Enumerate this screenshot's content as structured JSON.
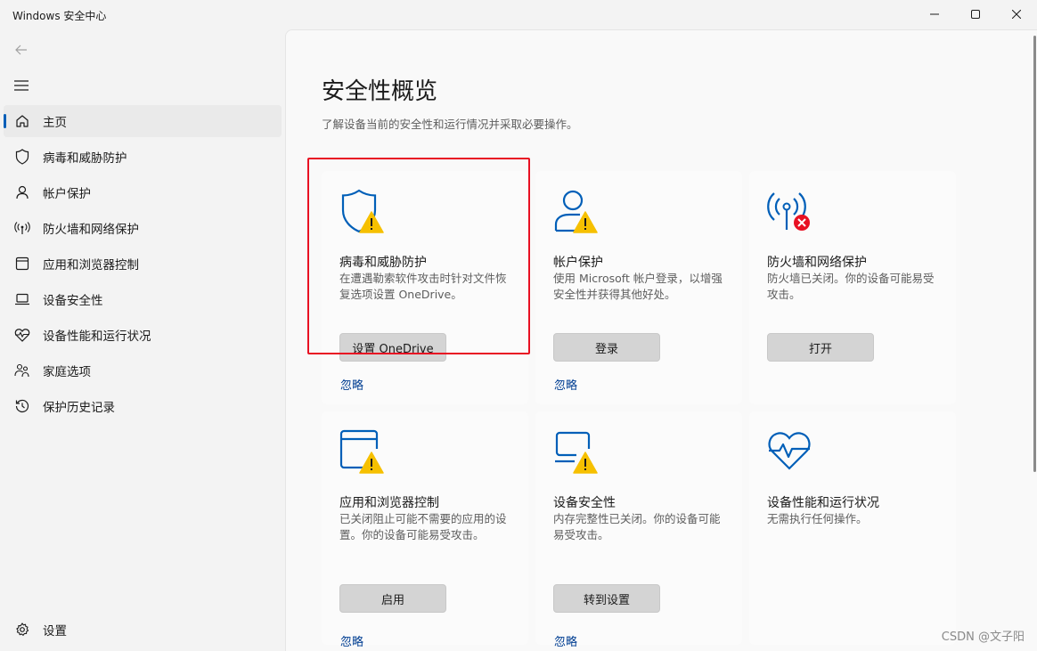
{
  "window": {
    "title": "Windows 安全中心",
    "controls": {
      "minimize": "minimize-icon",
      "maximize": "maximize-icon",
      "close": "close-icon"
    }
  },
  "sidebar": {
    "back_icon": "back-arrow-icon",
    "menu_icon": "hamburger-menu-icon",
    "items": [
      {
        "label": "主页",
        "icon": "home-icon",
        "active": true
      },
      {
        "label": "病毒和威胁防护",
        "icon": "shield-icon"
      },
      {
        "label": "帐户保护",
        "icon": "person-icon"
      },
      {
        "label": "防火墙和网络保护",
        "icon": "wireless-antenna-icon"
      },
      {
        "label": "应用和浏览器控制",
        "icon": "app-window-icon"
      },
      {
        "label": "设备安全性",
        "icon": "laptop-icon"
      },
      {
        "label": "设备性能和运行状况",
        "icon": "heart-pulse-icon"
      },
      {
        "label": "家庭选项",
        "icon": "family-icon"
      },
      {
        "label": "保护历史记录",
        "icon": "history-icon"
      }
    ],
    "settings": {
      "label": "设置",
      "icon": "gear-icon"
    }
  },
  "main": {
    "title": "安全性概览",
    "subtitle": "了解设备当前的安全性和运行情况并采取必要操作。",
    "cards": [
      {
        "title": "病毒和威胁防护",
        "description": "在遭遇勒索软件攻击时针对文件恢复选项设置 OneDrive。",
        "button": "设置 OneDrive",
        "link": "忽略",
        "icon": "shield-warning-icon",
        "status": "warning"
      },
      {
        "title": "帐户保护",
        "description": "使用 Microsoft 帐户登录，以增强安全性并获得其他好处。",
        "button": "登录",
        "link": "忽略",
        "icon": "person-warning-icon",
        "status": "warning"
      },
      {
        "title": "防火墙和网络保护",
        "description": "防火墙已关闭。你的设备可能易受攻击。",
        "button": "打开",
        "link": "",
        "icon": "antenna-error-icon",
        "status": "error"
      },
      {
        "title": "应用和浏览器控制",
        "description": "已关闭阻止可能不需要的应用的设置。你的设备可能易受攻击。",
        "button": "启用",
        "link": "忽略",
        "icon": "app-window-warning-icon",
        "status": "warning"
      },
      {
        "title": "设备安全性",
        "description": "内存完整性已关闭。你的设备可能易受攻击。",
        "button": "转到设置",
        "link": "忽略",
        "icon": "laptop-warning-icon",
        "status": "warning"
      },
      {
        "title": "设备性能和运行状况",
        "description": "无需执行任何操作。",
        "button": "",
        "link": "",
        "icon": "heart-pulse-icon",
        "status": "ok"
      }
    ]
  },
  "watermark": "CSDN @文子阳",
  "colors": {
    "accent": "#005fb8",
    "warning": "#f6c000",
    "error": "#e81123",
    "link": "#003e92",
    "highlight": "#e81123"
  }
}
